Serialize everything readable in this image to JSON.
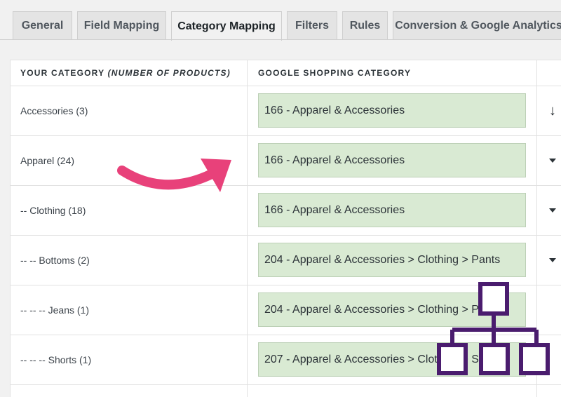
{
  "tabs": [
    {
      "label": "General"
    },
    {
      "label": "Field Mapping"
    },
    {
      "label": "Category Mapping"
    },
    {
      "label": "Filters"
    },
    {
      "label": "Rules"
    },
    {
      "label": "Conversion & Google Analytics"
    }
  ],
  "table": {
    "header": {
      "your_category": "YOUR CATEGORY",
      "your_category_note": "(NUMBER OF PRODUCTS)",
      "google_category": "GOOGLE SHOPPING CATEGORY"
    },
    "rows": [
      {
        "category": "Accessories (3)",
        "google": "166 - Apparel & Accessories"
      },
      {
        "category": "Apparel (24)",
        "google": "166 - Apparel & Accessories"
      },
      {
        "category": "-- Clothing (18)",
        "google": "166 - Apparel & Accessories"
      },
      {
        "category": "-- -- Bottoms (2)",
        "google": "204 - Apparel & Accessories > Clothing > Pants"
      },
      {
        "category": "-- -- -- Jeans (1)",
        "google": "204 - Apparel & Accessories > Clothing > Pants"
      },
      {
        "category": "-- -- -- Shorts (1)",
        "google": "207 - Apparel & Accessories > Clothing > Shorts"
      }
    ]
  },
  "icons": {
    "apply_down": "arrow-down-icon",
    "dropdown": "caret-down-icon",
    "pointer": "curved-arrow-icon",
    "hierarchy": "hierarchy-icon"
  },
  "colors": {
    "mapped_field_bg": "#d9ead3",
    "pointer_arrow": "#e8417a",
    "hierarchy_icon": "#4a1c6e"
  }
}
